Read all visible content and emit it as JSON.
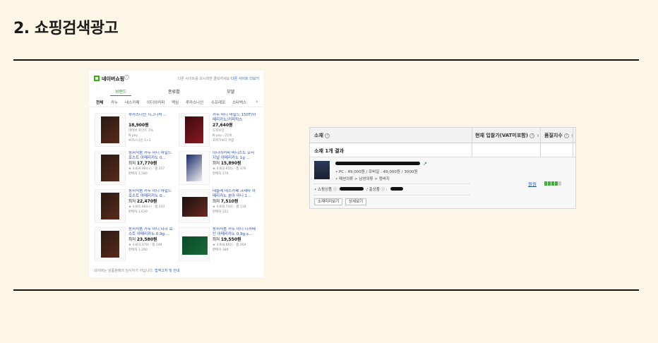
{
  "slide": {
    "title": "2. 쇼핑검색광고"
  },
  "shop": {
    "brand_name": "네이버쇼핑",
    "info_icon": "?",
    "head_note_prefix": "다른 사이트를 보시려면 클릭하세요",
    "head_note_link": "다른 사이트 더보기",
    "category_tabs": [
      "브랜드",
      "종류별",
      "모델"
    ],
    "filters": [
      "전체",
      "카누",
      "네스카페",
      "이디야커피",
      "맥심",
      "루카스나인",
      "수프레모",
      "스타벅스"
    ],
    "filter_arrow": "›",
    "products": [
      {
        "name": "루카스나인 시그니처 ...",
        "price_prefix": "",
        "price": "18,900원",
        "meta1": "네이버 포인트 1%",
        "meta2": "N pay",
        "meta3": "루카스나인 1+1"
      },
      {
        "name": "카누 미니 마일드 150T/아메리카노/커피믹스",
        "price_prefix": "",
        "price": "27,640원",
        "meta1": "도착보장",
        "meta2": "N pay · 25개",
        "meta3": "최저가보다 저렴"
      },
      {
        "name": "동서식품 카누 미니 마일드 로스트 아메리카노 0...",
        "price_prefix": "최저",
        "price": "17,770원",
        "meta1": "★ 4.8(9,984+)  ·  찜 257",
        "meta2": "판매처 1,580",
        "meta3": ""
      },
      {
        "name": "이디야커피 비니스트 오리지널 아메리카노 1g ...",
        "price_prefix": "최저",
        "price": "15,890원",
        "meta1": "★ 4.8(2,650)  ·  찜 376",
        "meta2": "판매처 176",
        "meta3": ""
      },
      {
        "name": "동서식품 카누 미니 마일드 로스트 아메리카노 0...",
        "price_prefix": "최저",
        "price": "22,470원",
        "meta1": "★ 4.8(5,984+)  ·  찜 333",
        "meta2": "판매처 1,630",
        "meta3": ""
      },
      {
        "name": "네슬레 네스카페 크레마 아메리카노 분아 미니 1...",
        "price_prefix": "최저",
        "price": "7,510원",
        "meta1": "★ 4.8(6,734)  ·  찜 118",
        "meta2": "판매처 221",
        "meta3": ""
      },
      {
        "name": "동서식품 카누 미니 다크 로스트 아메리카노 0.9g ...",
        "price_prefix": "최저",
        "price": "23,580원",
        "meta1": "★ 4.8(3,370)  ·  찜 248",
        "meta2": "판매처 1,290",
        "meta3": ""
      },
      {
        "name": "동서식품 카누 미니 디카페인 아메리카노 0.9g x...",
        "price_prefix": "최저",
        "price": "19,550원",
        "meta1": "★ 4.8(8,892)  ·  찜 269",
        "meta2": "판매처 389",
        "meta3": ""
      }
    ],
    "footer_prefix": "네이버는 상품판매의 당사자가 아닙니다.",
    "footer_link": "법적고지 및 안내"
  },
  "admin": {
    "headers": {
      "item": "소재",
      "bid": "현재 입찰가(VAT미포함)",
      "quality": "품질지수"
    },
    "help_icon": "?",
    "sort_icon": "⇕",
    "result_label": "소재 1개 결과",
    "ext_link_icon": "↗",
    "pc_line": "• PC : 49,000원   /    모바일 : 49,000원   /    3000원",
    "category_line": "• 패션의류 > 남성의류 > 청바지",
    "mall_label": "• 쇼핑상품 ⓘ :",
    "mall_label2": "/ 출상품 ⓘ :",
    "buttons": [
      "소재미리보기",
      "상세보기"
    ],
    "bid_value": "원원",
    "quality_level": 4,
    "quality_max": 5,
    "quality_color": "#3cb43c"
  }
}
